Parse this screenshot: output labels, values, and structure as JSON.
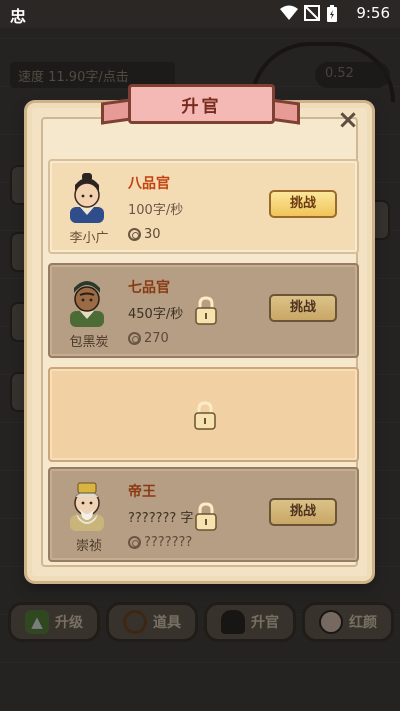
{
  "status_bar": {
    "app_glyph": "忠",
    "time": "9:56"
  },
  "background": {
    "speed_text": "速度 11.90字/点击",
    "coin_text": "0.52"
  },
  "bottom_nav": [
    {
      "label": "升级",
      "icon": "up-arrow-icon"
    },
    {
      "label": "道具",
      "icon": "wreath-icon"
    },
    {
      "label": "升官",
      "icon": "hat-icon"
    },
    {
      "label": "红颜",
      "icon": "lady-icon"
    }
  ],
  "modal": {
    "title": "升官",
    "close": "×",
    "ranks": [
      {
        "title": "八品官",
        "speed": "100字/秒",
        "person": "李小广",
        "cost": "30",
        "button": "挑战",
        "state": "unlocked"
      },
      {
        "title": "七品官",
        "speed": "450字/秒",
        "person": "包黑炭",
        "cost": "270",
        "button": "挑战",
        "state": "locked"
      },
      {
        "state": "empty"
      },
      {
        "title": "帝王",
        "speed": "??????? 字",
        "person": "崇祯",
        "cost": "???????",
        "button": "挑战",
        "state": "locked"
      }
    ]
  },
  "colors": {
    "accent": "#c2410c",
    "ribbon": "#f4b8b5",
    "button": "#f1c45a"
  }
}
